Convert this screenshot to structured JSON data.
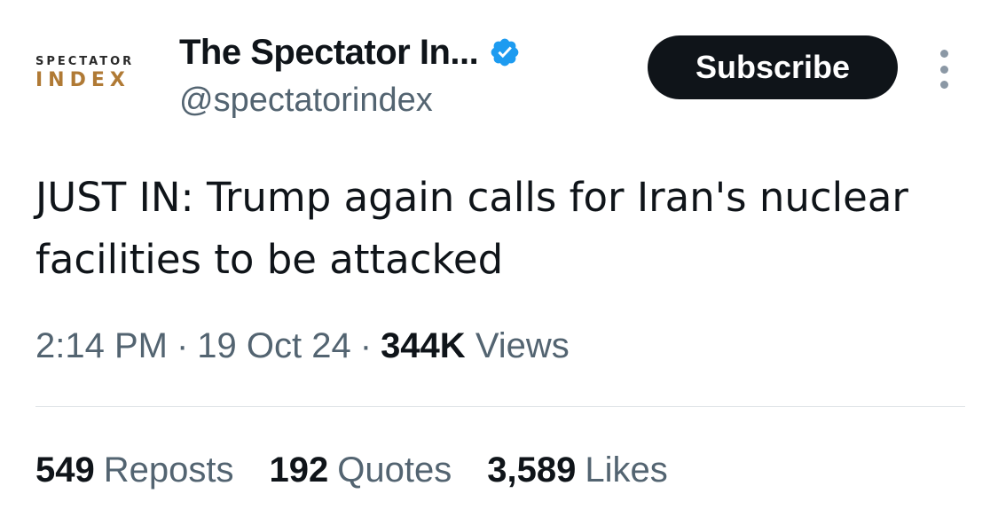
{
  "account": {
    "logo_top": "SPECTATOR",
    "logo_bottom": "INDEX",
    "display_name": "The Spectator In...",
    "handle": "@spectatorindex",
    "verified_color": "#1d9bf0"
  },
  "actions": {
    "subscribe_label": "Subscribe",
    "more_icon": "more-vertical-icon"
  },
  "tweet": {
    "text": "JUST IN: Trump again calls for Iran's nuclear facilities to be attacked"
  },
  "meta": {
    "time": "2:14 PM",
    "separator": "·",
    "date": "19 Oct 24",
    "views_count": "344K",
    "views_label": "Views"
  },
  "stats": {
    "reposts_count": "549",
    "reposts_label": "Reposts",
    "quotes_count": "192",
    "quotes_label": "Quotes",
    "likes_count": "3,589",
    "likes_label": "Likes"
  }
}
